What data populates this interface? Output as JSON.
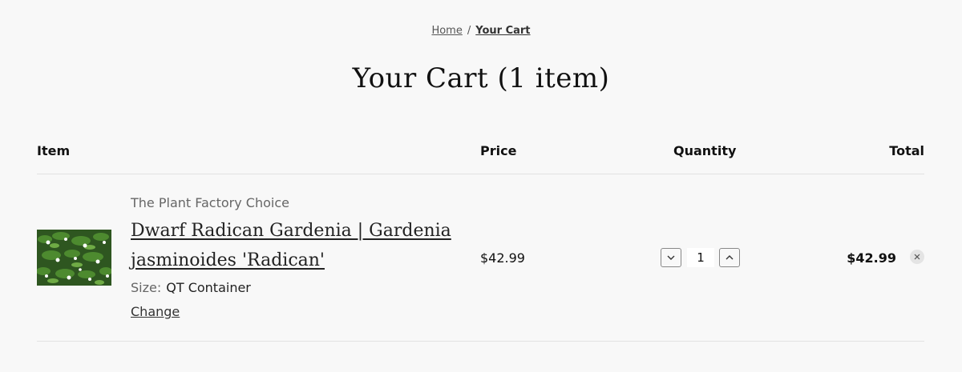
{
  "breadcrumb": {
    "home": "Home",
    "separator": "/",
    "current": "Your Cart"
  },
  "page_title": "Your Cart (1 item)",
  "table": {
    "headers": {
      "item": "Item",
      "price": "Price",
      "quantity": "Quantity",
      "total": "Total"
    }
  },
  "cart_items": [
    {
      "vendor": "The Plant Factory Choice",
      "title": "Dwarf Radican Gardenia | Gardenia jasminoides 'Radican'",
      "variant_label": "Size:",
      "variant_value": "QT Container",
      "change_label": "Change",
      "price": "$42.99",
      "quantity": "1",
      "line_total": "$42.99",
      "image_icon": "gardenia-product-photo"
    }
  ],
  "icons": {
    "decrease": "chevron-down-icon",
    "increase": "chevron-up-icon",
    "remove": "close-icon"
  },
  "colors": {
    "background": "#f8f8f8",
    "divider": "#e2e2e2",
    "text": "#111111",
    "muted": "#666666",
    "remove_bg": "#e4e4e4"
  }
}
